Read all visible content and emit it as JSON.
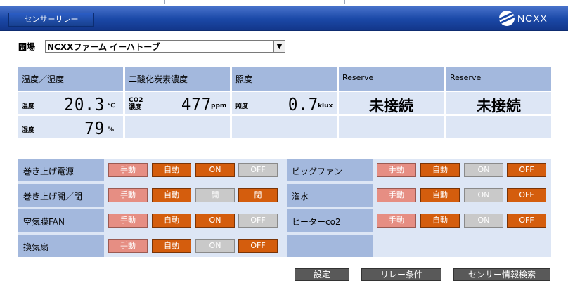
{
  "header": {
    "tab_label": "センサーリレー",
    "logo_text": "NCXX"
  },
  "farm": {
    "label": "圃場",
    "selected": "NCXXファーム イーハトーブ"
  },
  "sensors": [
    {
      "title": "温度／湿度",
      "r1": {
        "label": "温度",
        "value": "20.3",
        "unit": "℃"
      },
      "r2": {
        "label": "湿度",
        "value": "79",
        "unit": "%"
      }
    },
    {
      "title": "二酸化炭素濃度",
      "r1": {
        "label1": "CO2",
        "label2": "濃度",
        "value": "477",
        "unit": "ppm"
      }
    },
    {
      "title": "照度",
      "r1": {
        "label": "照度",
        "value": "0.7",
        "unit": "klux"
      }
    },
    {
      "title": "Reserve",
      "status": "未接続"
    },
    {
      "title": "Reserve",
      "status": "未接続"
    }
  ],
  "controls": {
    "left": [
      {
        "name": "巻き上げ電源",
        "b": [
          "手動",
          "自動",
          "ON",
          "OFF"
        ]
      },
      {
        "name": "巻き上げ開／閉",
        "b": [
          "手動",
          "自動",
          "開",
          "閉"
        ]
      },
      {
        "name": "空気膜FAN",
        "b": [
          "手動",
          "自動",
          "ON",
          "OFF"
        ]
      },
      {
        "name": "換気扇",
        "b": [
          "手動",
          "自動",
          "ON",
          "OFF"
        ]
      }
    ],
    "right": [
      {
        "name": "ビッグファン",
        "b": [
          "手動",
          "自動",
          "ON",
          "OFF"
        ]
      },
      {
        "name": "潅水",
        "b": [
          "手動",
          "自動",
          "ON",
          "OFF"
        ]
      },
      {
        "name": "ヒーターco2",
        "b": [
          "手動",
          "自動",
          "ON",
          "OFF"
        ]
      }
    ]
  },
  "footer": {
    "settings": "設定",
    "relay_conditions": "リレー条件",
    "sensor_search": "センサー情報検索"
  }
}
